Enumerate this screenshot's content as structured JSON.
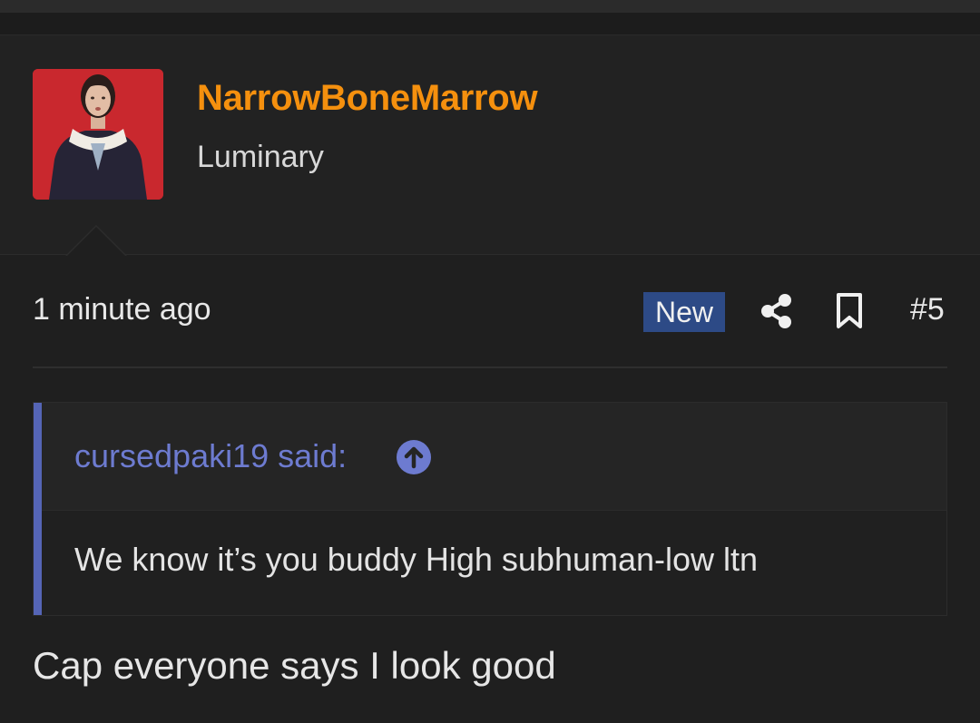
{
  "user": {
    "name": "NarrowBoneMarrow",
    "title": "Luminary",
    "name_color": "#f5900e"
  },
  "meta": {
    "timestamp": "1 minute ago",
    "badge": "New",
    "post_number": "#5",
    "icons": [
      "share-icon",
      "bookmark-icon"
    ]
  },
  "quote": {
    "author": "cursedpaki19 said:",
    "icon": "arrow-up-circle-icon",
    "text": "We know it’s you buddy High subhuman-low ltn",
    "accent_color": "#5565b6"
  },
  "post": {
    "text": "Cap everyone says I look good"
  }
}
